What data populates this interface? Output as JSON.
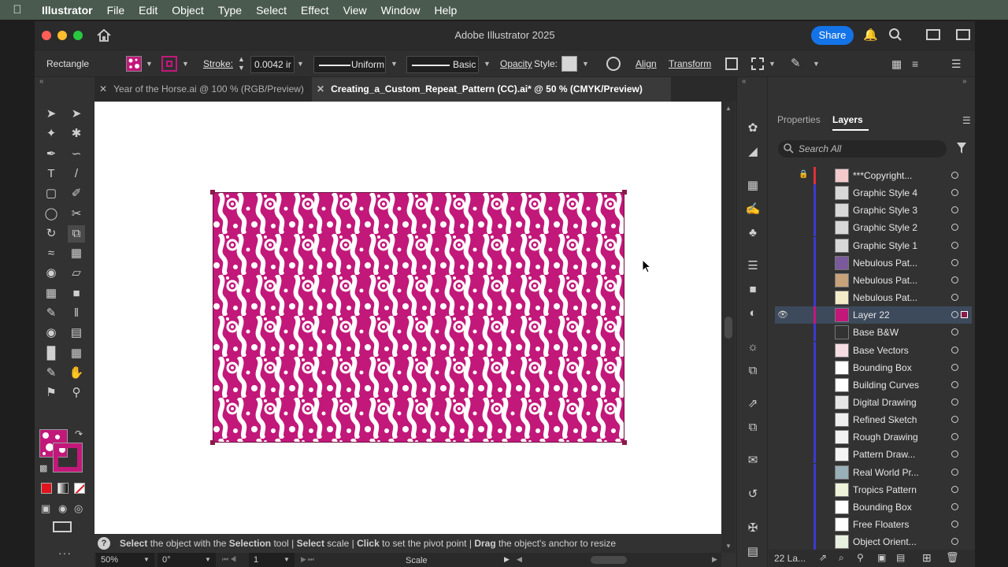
{
  "menubar": {
    "app_name": "Illustrator",
    "items": [
      "File",
      "Edit",
      "Object",
      "Type",
      "Select",
      "Effect",
      "View",
      "Window",
      "Help"
    ]
  },
  "window": {
    "title": "Adobe Illustrator 2025",
    "share_label": "Share"
  },
  "control_bar": {
    "selection_type": "Rectangle",
    "stroke_label": "Stroke:",
    "stroke_value": "0.0042 ir",
    "profile_label": "Uniform",
    "brush_label": "Basic",
    "opacity_label": "Opacity",
    "style_label": "Style:",
    "align_label": "Align",
    "transform_label": "Transform",
    "fill_color": "#c2187a"
  },
  "tabs": [
    {
      "label": "Year of the Horse.ai @ 100 % (RGB/Preview)",
      "active": false
    },
    {
      "label": "Creating_a_Custom_Repeat_Pattern (CC).ai* @ 50 % (CMYK/Preview)",
      "active": true
    }
  ],
  "tools": [
    "selection-icon",
    "direct-selection-icon",
    "magic-wand-icon",
    "lasso-icon",
    "pen-icon",
    "curvature-icon",
    "type-icon",
    "line-icon",
    "rectangle-icon",
    "paintbrush-icon",
    "shaper-icon",
    "scissors-icon",
    "rotate-icon",
    "scale-icon",
    "warp-icon",
    "free-transform-icon",
    "shape-builder-icon",
    "perspective-icon",
    "mesh-icon",
    "gradient-icon",
    "eyedropper-icon",
    "measure-icon",
    "symbol-sprayer-icon",
    "slice-icon",
    "graph-icon",
    "artboard-icon",
    "pencil-icon",
    "hand-icon",
    "puppet-warp-icon",
    "zoom-icon"
  ],
  "artwork": {
    "pattern_color": "#c2187a",
    "background_color": "#ffffff"
  },
  "status": {
    "parts": [
      {
        "bold": "Select",
        "text": " the object with the "
      },
      {
        "bold": "Selection",
        "text": " tool  |  "
      },
      {
        "bold": "Select",
        "text": " scale  |  "
      },
      {
        "bold": "Click",
        "text": " to set the pivot point  |  "
      },
      {
        "bold": "Drag",
        "text": " the object's anchor to resize"
      }
    ]
  },
  "bottombar": {
    "zoom": "50%",
    "rotation": "0°",
    "artboard": "1",
    "mode": "Scale"
  },
  "panels": {
    "properties_tab": "Properties",
    "layers_tab": "Layers",
    "search_placeholder": "Search All",
    "layer_count": "22 La..."
  },
  "layers": [
    {
      "name": "***Copyright...",
      "color": "#e0303a",
      "locked": true,
      "visible": false,
      "thumb": "#f3c9cc",
      "selected": false
    },
    {
      "name": "Graphic Style 4",
      "color": "#3a3ad0",
      "locked": false,
      "visible": false,
      "thumb": "#d8d8d8",
      "selected": false
    },
    {
      "name": "Graphic Style 3",
      "color": "#3a3ad0",
      "locked": false,
      "visible": false,
      "thumb": "#d8d8d8",
      "selected": false
    },
    {
      "name": "Graphic Style 2",
      "color": "#3a3ad0",
      "locked": false,
      "visible": false,
      "thumb": "#d8d8d8",
      "selected": false
    },
    {
      "name": "Graphic Style 1",
      "color": "#3a3ad0",
      "locked": false,
      "visible": false,
      "thumb": "#d8d8d8",
      "selected": false
    },
    {
      "name": "Nebulous Pat...",
      "color": "#3a3ad0",
      "locked": false,
      "visible": false,
      "thumb": "#7a5a9a",
      "selected": false
    },
    {
      "name": "Nebulous Pat...",
      "color": "#3a3ad0",
      "locked": false,
      "visible": false,
      "thumb": "#c8a27a",
      "selected": false
    },
    {
      "name": "Nebulous Pat...",
      "color": "#3a3ad0",
      "locked": false,
      "visible": false,
      "thumb": "#f4ecc8",
      "selected": false
    },
    {
      "name": "Layer 22",
      "color": "#c2187a",
      "locked": false,
      "visible": true,
      "thumb": "#c2187a",
      "selected": true
    },
    {
      "name": "Base B&W",
      "color": "#3a3ad0",
      "locked": false,
      "visible": false,
      "thumb": "#333333",
      "selected": false
    },
    {
      "name": "Base Vectors",
      "color": "#3a3ad0",
      "locked": false,
      "visible": false,
      "thumb": "#f6dde4",
      "selected": false
    },
    {
      "name": "Bounding Box",
      "color": "#3a3ad0",
      "locked": false,
      "visible": false,
      "thumb": "#ffffff",
      "selected": false
    },
    {
      "name": "Building Curves",
      "color": "#3a3ad0",
      "locked": false,
      "visible": false,
      "thumb": "#ffffff",
      "selected": false
    },
    {
      "name": "Digital Drawing",
      "color": "#3a3ad0",
      "locked": false,
      "visible": false,
      "thumb": "#e6e6e6",
      "selected": false
    },
    {
      "name": "Refined Sketch",
      "color": "#3a3ad0",
      "locked": false,
      "visible": false,
      "thumb": "#eeeeee",
      "selected": false
    },
    {
      "name": "Rough Drawing",
      "color": "#3a3ad0",
      "locked": false,
      "visible": false,
      "thumb": "#f2f2f2",
      "selected": false
    },
    {
      "name": "Pattern Draw...",
      "color": "#3a3ad0",
      "locked": false,
      "visible": false,
      "thumb": "#f4f4f4",
      "selected": false
    },
    {
      "name": "Real World Pr...",
      "color": "#3a3ad0",
      "locked": false,
      "visible": false,
      "thumb": "#9ab0b8",
      "selected": false
    },
    {
      "name": "Tropics Pattern",
      "color": "#3a3ad0",
      "locked": false,
      "visible": false,
      "thumb": "#eef2d8",
      "selected": false
    },
    {
      "name": "Bounding Box",
      "color": "#3a3ad0",
      "locked": false,
      "visible": false,
      "thumb": "#ffffff",
      "selected": false
    },
    {
      "name": "Free Floaters",
      "color": "#3a3ad0",
      "locked": false,
      "visible": false,
      "thumb": "#ffffff",
      "selected": false
    },
    {
      "name": "Object Orient...",
      "color": "#3a3ad0",
      "locked": false,
      "visible": false,
      "thumb": "#e8f0e0",
      "selected": false
    }
  ]
}
